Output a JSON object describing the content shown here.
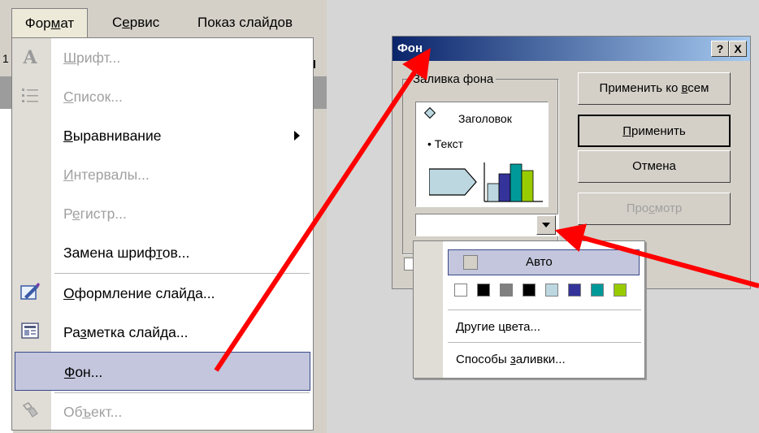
{
  "menubar": {
    "format": "Формат",
    "service": "Сервис",
    "show": "Показ слайдов",
    "ruler_number": "1"
  },
  "format_menu": {
    "items": [
      {
        "label": "Шрифт...",
        "enabled": false,
        "icon": "font-a-icon"
      },
      {
        "label": "Список...",
        "enabled": false,
        "icon": "bullet-list-icon"
      },
      {
        "label": "Выравнивание",
        "enabled": true,
        "submenu": true
      },
      {
        "label": "Интервалы...",
        "enabled": false
      },
      {
        "label": "Регистр...",
        "enabled": false
      },
      {
        "label": "Замена шрифтов...",
        "enabled": true
      },
      {
        "label": "Оформление слайда...",
        "enabled": true,
        "icon": "slide-design-icon"
      },
      {
        "label": "Разметка слайда...",
        "enabled": true,
        "icon": "slide-layout-icon"
      },
      {
        "label": "Фон...",
        "enabled": true,
        "highlighted": true
      },
      {
        "label": "Объект...",
        "enabled": false,
        "icon": "object-icon"
      }
    ]
  },
  "dialog": {
    "title": "Фон",
    "help": "?",
    "close": "X",
    "group_label": "Заливка фона",
    "preview_title": "Заголовок",
    "preview_text": "• Текст",
    "buttons": {
      "apply_all": "Применить ко всем",
      "apply": "Применить",
      "cancel": "Отмена",
      "preview": "Просмотр"
    }
  },
  "color_dropdown": {
    "auto": "Авто",
    "more_colors": "Другие цвета...",
    "fill_effects": "Способы заливки...",
    "swatches": [
      "#ffffff",
      "#000000",
      "#808080",
      "#000000",
      "#bcd7e0",
      "#333399",
      "#009999",
      "#99cc00"
    ]
  },
  "colors": {
    "highlight": "#c3c6dc",
    "arrow": "#ff0000",
    "titlebar": "#0a246a"
  }
}
